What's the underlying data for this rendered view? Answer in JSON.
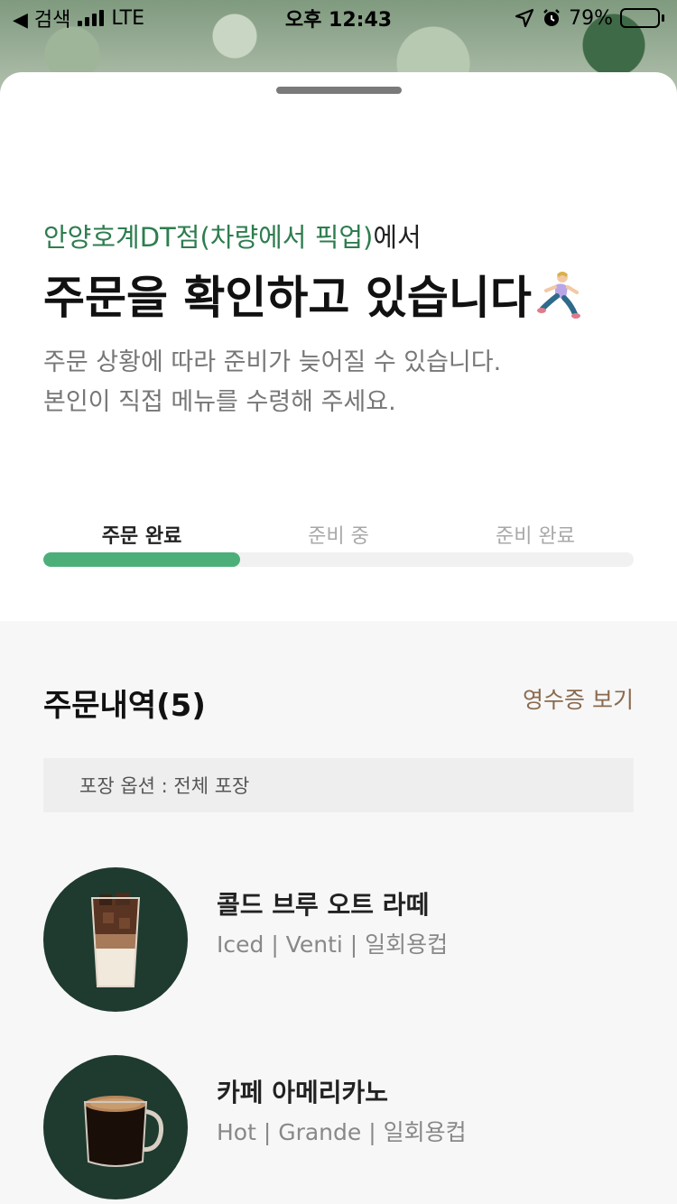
{
  "status_bar": {
    "back_label": "◀ 검색",
    "carrier": "LTE",
    "time": "오후 12:43",
    "battery": "79%",
    "battery_level": 0.79
  },
  "order": {
    "store": "안양호계DT점(차량에서 픽업)",
    "store_suffix": "에서",
    "headline": "주문을 확인하고 있습니다",
    "notice_line1": "주문 상황에 따라 준비가 늦어질 수 있습니다.",
    "notice_line2": "본인이 직접 메뉴를 수령해 주세요."
  },
  "steps": [
    {
      "label": "주문 완료"
    },
    {
      "label": "준비 중"
    },
    {
      "label": "준비 완료"
    }
  ],
  "progress": 0.333,
  "history": {
    "title": "주문내역(5)",
    "receipt_link": "영수증 보기",
    "packaging": "포장 옵션 : 전체 포장"
  },
  "items": [
    {
      "name": "콜드 브루 오트 라떼",
      "options": "Iced | Venti | 일회용컵"
    },
    {
      "name": "카페 아메리카노",
      "options": "Hot | Grande | 일회용컵"
    }
  ],
  "colors": {
    "accent": "#2e7d4f",
    "progress": "#4caf7a",
    "link": "#8a6a4f"
  }
}
